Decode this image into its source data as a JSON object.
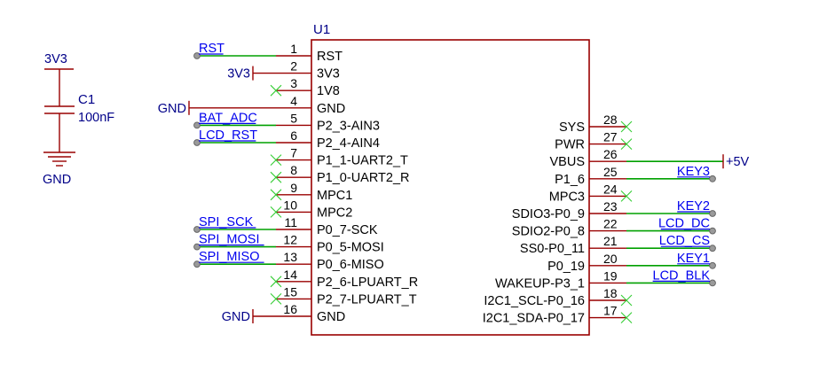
{
  "ic": {
    "designator": "U1",
    "left_pins": [
      {
        "num": "1",
        "name": "RST",
        "net": "RST",
        "kind": "label"
      },
      {
        "num": "2",
        "name": "3V3",
        "net": "3V3",
        "kind": "power"
      },
      {
        "num": "3",
        "name": "1V8",
        "net": "",
        "kind": "nc"
      },
      {
        "num": "4",
        "name": "GND",
        "net": "GND",
        "kind": "power"
      },
      {
        "num": "5",
        "name": "P2_3-AIN3",
        "net": "BAT_ADC",
        "kind": "label"
      },
      {
        "num": "6",
        "name": "P2_4-AIN4",
        "net": "LCD_RST",
        "kind": "label"
      },
      {
        "num": "7",
        "name": "P1_1-UART2_T",
        "net": "",
        "kind": "nc"
      },
      {
        "num": "8",
        "name": "P1_0-UART2_R",
        "net": "",
        "kind": "nc"
      },
      {
        "num": "9",
        "name": "MPC1",
        "net": "",
        "kind": "nc"
      },
      {
        "num": "10",
        "name": "MPC2",
        "net": "",
        "kind": "nc"
      },
      {
        "num": "11",
        "name": "P0_7-SCK",
        "net": "SPI_SCK",
        "kind": "label"
      },
      {
        "num": "12",
        "name": "P0_5-MOSI",
        "net": "SPI_MOSI",
        "kind": "label"
      },
      {
        "num": "13",
        "name": "P0_6-MISO",
        "net": "SPI_MISO",
        "kind": "label"
      },
      {
        "num": "14",
        "name": "P2_6-LPUART_R",
        "net": "",
        "kind": "nc"
      },
      {
        "num": "15",
        "name": "P2_7-LPUART_T",
        "net": "",
        "kind": "nc"
      },
      {
        "num": "16",
        "name": "GND",
        "net": "GND",
        "kind": "power"
      }
    ],
    "right_pins": [
      {
        "num": "28",
        "name": "SYS",
        "net": "",
        "kind": "nc"
      },
      {
        "num": "27",
        "name": "PWR",
        "net": "",
        "kind": "nc"
      },
      {
        "num": "26",
        "name": "VBUS",
        "net": "+5V",
        "kind": "power"
      },
      {
        "num": "25",
        "name": "P1_6",
        "net": "KEY3",
        "kind": "label"
      },
      {
        "num": "24",
        "name": "MPC3",
        "net": "",
        "kind": "nc"
      },
      {
        "num": "23",
        "name": "SDIO3-P0_9",
        "net": "KEY2",
        "kind": "label"
      },
      {
        "num": "22",
        "name": "SDIO2-P0_8",
        "net": "LCD_DC",
        "kind": "label"
      },
      {
        "num": "21",
        "name": "SS0-P0_11",
        "net": "LCD_CS",
        "kind": "label"
      },
      {
        "num": "20",
        "name": "P0_19",
        "net": "KEY1",
        "kind": "label"
      },
      {
        "num": "19",
        "name": "WAKEUP-P3_1",
        "net": "LCD_BLK",
        "kind": "label"
      },
      {
        "num": "18",
        "name": "I2C1_SCL-P0_16",
        "net": "",
        "kind": "nc"
      },
      {
        "num": "17",
        "name": "I2C1_SDA-P0_17",
        "net": "",
        "kind": "nc"
      }
    ]
  },
  "capacitor": {
    "designator": "C1",
    "value": "100nF",
    "top_net": "3V3",
    "bottom_net": "GND"
  },
  "colors": {
    "part_outline": "#990000",
    "wire": "#00a000",
    "no_connect": "#33cc33",
    "net_label": "#0000ee",
    "power_label": "#000088"
  }
}
